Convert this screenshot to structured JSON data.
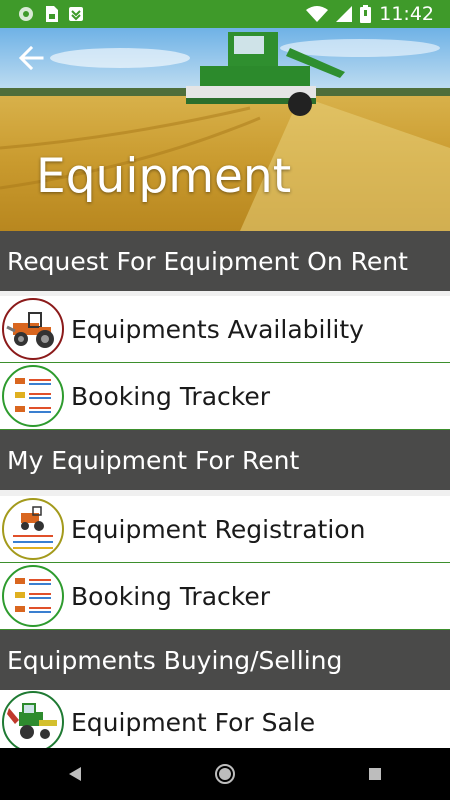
{
  "status_bar": {
    "time": "11:42",
    "icons": [
      "circle-icon",
      "sim-card-icon",
      "download-icon",
      "wifi-icon",
      "signal-icon",
      "battery-icon"
    ]
  },
  "header": {
    "title": "Equipment",
    "back_icon": "back-arrow-icon"
  },
  "sections": [
    {
      "title": "Request For Equipment On Rent",
      "items": [
        {
          "label": "Equipments Availability",
          "icon": "tractor-icon",
          "ring_color": "#8b1a1a"
        },
        {
          "label": "Booking Tracker",
          "icon": "booking-list-icon",
          "ring_color": "#2e9b2e"
        }
      ]
    },
    {
      "title": "My Equipment For Rent",
      "items": [
        {
          "label": "Equipment Registration",
          "icon": "registration-icon",
          "ring_color": "#a39a1c"
        },
        {
          "label": "Booking Tracker",
          "icon": "booking-list-icon",
          "ring_color": "#2e9b2e"
        }
      ]
    },
    {
      "title": "Equipments Buying/Selling",
      "items": [
        {
          "label": "Equipment For Sale",
          "icon": "harvester-icon",
          "ring_color": "#1f7a33"
        }
      ]
    }
  ],
  "nav": {
    "back": "nav-back-icon",
    "home": "nav-home-icon",
    "recents": "nav-recents-icon"
  },
  "colors": {
    "status_bar": "#3f9a2a",
    "section_header": "#4a4a49",
    "divider": "#3d8f2d"
  }
}
